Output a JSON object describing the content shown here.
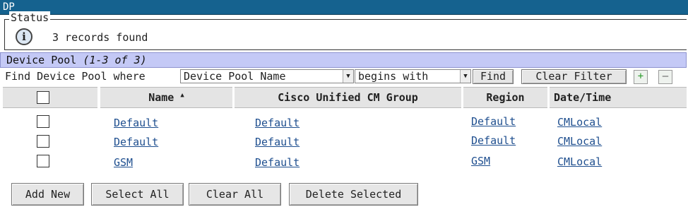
{
  "window": {
    "title": "DP"
  },
  "status": {
    "legend": "Status",
    "icon": "info-icon",
    "icon_glyph": "i",
    "message": "3 records found"
  },
  "pool_header": {
    "title": "Device Pool",
    "range": "(1-3 of 3)"
  },
  "search": {
    "label": "Find Device Pool where",
    "field_value": "Device Pool Name",
    "operator_value": "begins with",
    "find_label": "Find",
    "clear_filter_label": "Clear Filter",
    "add_criteria_label": "+",
    "remove_criteria_label": "–"
  },
  "table": {
    "columns": [
      "Name",
      "Cisco Unified CM Group",
      "Region",
      "Date/Time"
    ],
    "sort_indicator": "▲",
    "rows": [
      {
        "name": "Default",
        "cm_group": "Default",
        "region": "Default",
        "date_time": "CMLocal"
      },
      {
        "name": "Default",
        "cm_group": "Default",
        "region": "Default",
        "date_time": "CMLocal"
      },
      {
        "name": "GSM",
        "cm_group": "Default",
        "region": "GSM",
        "date_time": "CMLocal"
      }
    ]
  },
  "actions": {
    "add_new": "Add New",
    "select_all": "Select All",
    "clear_all": "Clear All",
    "delete_selected": "Delete Selected"
  }
}
